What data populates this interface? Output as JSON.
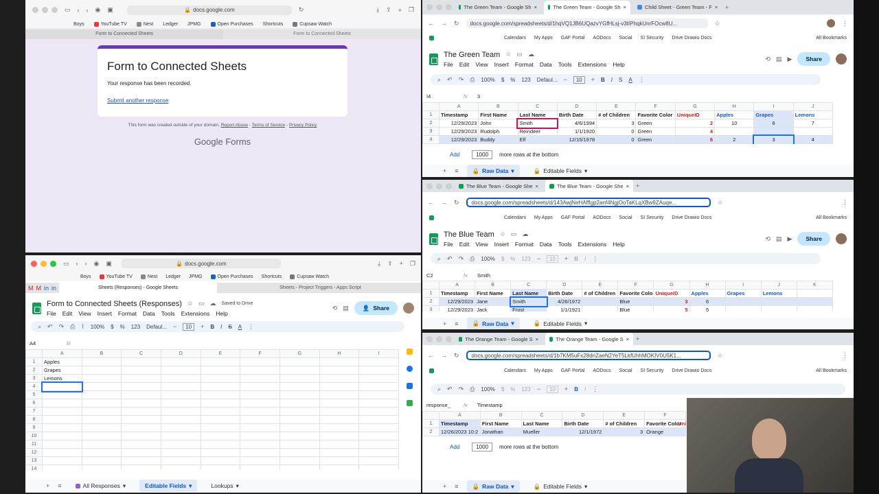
{
  "form_window": {
    "url": "docs.google.com",
    "bookmarks": [
      "Boys",
      "YouTube TV",
      "Nest",
      "Ledger",
      "JPMG",
      "Open Purchases",
      "Shortcuts",
      "Cupsaw Watch"
    ],
    "tabs": [
      "Form to Connected Sheets",
      "Form to Connected Sheets"
    ],
    "title": "Form to Connected Sheets",
    "message": "Your response has been recorded.",
    "link": "Submit another response",
    "footer_pre": "This form was created outside of your domain.",
    "report": "Report Abuse",
    "terms": "Terms of Service",
    "privacy": "Privacy Policy",
    "brand": "Google Forms"
  },
  "responses_window": {
    "url": "docs.google.com",
    "bookmarks": [
      "Boys",
      "YouTube TV",
      "Nest",
      "Ledger",
      "JPMG",
      "Open Purchases",
      "Shortcuts",
      "Cupsaw Watch"
    ],
    "tabs": [
      "Sheets (Responses) - Google Sheets",
      "Sheets - Project Triggers - Apps Script"
    ],
    "doc_title": "Form to Connected Sheets (Responses)",
    "saved": "Saved to Drive",
    "menu": [
      "File",
      "Edit",
      "View",
      "Insert",
      "Format",
      "Data",
      "Tools",
      "Extensions",
      "Help"
    ],
    "share": "Share",
    "zoom": "100%",
    "font": "Defaul...",
    "font_size": "10",
    "num_fmt": "123",
    "cell_ref": "A4",
    "fx": "fx",
    "columns": [
      "A",
      "B",
      "C",
      "D",
      "E",
      "F",
      "G",
      "H",
      "I"
    ],
    "rows": [
      [
        "Apples"
      ],
      [
        "Grapes"
      ],
      [
        "Lemons"
      ],
      [
        ""
      ],
      [
        ""
      ],
      [
        ""
      ],
      [
        ""
      ],
      [
        ""
      ],
      [
        ""
      ],
      [
        ""
      ],
      [
        ""
      ],
      [
        ""
      ],
      [
        ""
      ],
      [
        ""
      ]
    ],
    "sheet_tabs": [
      "All Responses",
      "Editable Fields",
      "Lookups"
    ]
  },
  "green_window": {
    "tabs": [
      "The Green Team - Google Sh",
      "The Green Team - Google Sh",
      "Child Sheet - Green Team - F"
    ],
    "url": "docs.google.com/spreadsheets/d/1hqVQ1JB6UQazvYGfHLsj-v3tIPhqkUnrFOcw8U...",
    "bookmarks": [
      "Calendars",
      "My Apps",
      "GAF Portal",
      "AODocs",
      "Social",
      "SI Security",
      "Drive Drawio Docs",
      "All Bookmarks"
    ],
    "doc_title": "The Green Team",
    "menu": [
      "File",
      "Edit",
      "View",
      "Insert",
      "Format",
      "Data",
      "Tools",
      "Extensions",
      "Help"
    ],
    "share": "Share",
    "zoom": "100%",
    "font": "Defaul...",
    "font_size": "10",
    "num_fmt": "123",
    "cell_ref": "I4",
    "formula": "3",
    "columns": [
      "A",
      "B",
      "C",
      "D",
      "E",
      "F",
      "G",
      "H",
      "I",
      "J"
    ],
    "headers": [
      "Timestamp",
      "First Name",
      "Last Name",
      "Birth Date",
      "# of Children",
      "Favorite Color",
      "UniqueID",
      "Apples",
      "Grapes",
      "Lemons"
    ],
    "rows": [
      [
        "12/29/2023",
        "John",
        "Smith",
        "4/6/1994",
        "3",
        "Green",
        "2",
        "10",
        "6",
        "7"
      ],
      [
        "12/29/2023",
        "Rudolph",
        "Reindeer",
        "1/1/1920",
        "0",
        "Green",
        "4",
        "",
        "",
        ""
      ],
      [
        "12/29/2023",
        "Buddy",
        "Elf",
        "12/15/1978",
        "0",
        "Green",
        "6",
        "2",
        "3",
        "4"
      ]
    ],
    "add": "Add",
    "add_count": "1000",
    "add_text": "more rows at the bottom",
    "sheet_tabs": [
      "Raw Data",
      "Editable Fields"
    ]
  },
  "blue_window": {
    "tabs": [
      "The Blue Team - Google She",
      "The Blue Team - Google She"
    ],
    "url": "docs.google.com/spreadsheets/d/143AwjNeHAfflgp2anf4NgjOoTaKLqXBw9ZAuqe...",
    "bookmarks": [
      "Calendars",
      "My Apps",
      "GAF Portal",
      "AODocs",
      "Social",
      "SI Security",
      "Drive Drawio Docs",
      "All Bookmarks"
    ],
    "doc_title": "The Blue Team",
    "menu": [
      "File",
      "Edit",
      "View",
      "Insert",
      "Format",
      "Data",
      "Tools",
      "Extensions",
      "Help"
    ],
    "share": "Share",
    "zoom": "100%",
    "font_size": "10",
    "num_fmt": "123",
    "cell_ref": "C2",
    "formula": "Smith",
    "columns": [
      "A",
      "B",
      "C",
      "D",
      "E",
      "F",
      "G",
      "H",
      "I",
      "J",
      "K"
    ],
    "headers": [
      "Timestamp",
      "First Name",
      "Last Name",
      "Birth Date",
      "# of Children",
      "Favorite Color",
      "UniqueID",
      "Apples",
      "Grapes",
      "Lemons",
      ""
    ],
    "rows": [
      [
        "12/29/2023",
        "Jane",
        "Smith",
        "4/26/1972",
        "",
        "Blue",
        "3",
        "6",
        "",
        "",
        ""
      ],
      [
        "12/29/2023",
        "Jack",
        "Frost",
        "1/1/1921",
        "",
        "Blue",
        "5",
        "5",
        "",
        "",
        ""
      ]
    ],
    "sheet_tabs": [
      "Raw Data",
      "Editable Fields"
    ]
  },
  "orange_window": {
    "tabs": [
      "The Orange Team - Google S",
      "The Orange Team - Google S"
    ],
    "url": "docs.google.com/spreadsheets/d/1b7KM5uFx28dnZaeN2YeT5LkfUhhMOKIV0U5K1...",
    "bookmarks": [
      "Calendars",
      "My Apps",
      "GAF Portal",
      "AODocs",
      "Social",
      "SI Security",
      "Drive Drawio Docs",
      "All Bookmarks"
    ],
    "zoom": "100%",
    "font_size": "10",
    "num_fmt": "123",
    "cell_ref": "response_",
    "formula": "Timestamp",
    "columns": [
      "A",
      "B",
      "C",
      "D",
      "E",
      "F"
    ],
    "headers": [
      "Timestamp",
      "First Name",
      "Last Name",
      "Birth Date",
      "# of Children",
      "Favorite Color"
    ],
    "rows": [
      [
        "12/26/2023 10:2",
        "Jonathan",
        "Mueller",
        "12/1/1972",
        "3",
        "Orange"
      ]
    ],
    "extra_header": "Uni",
    "add": "Add",
    "add_count": "1000",
    "add_text": "more rows at the bottom",
    "sheet_tabs": [
      "Raw Data",
      "Editable Fields"
    ]
  },
  "colors": {
    "form_bg": "#ede7f6",
    "form_accent": "#673ab7",
    "sheets_green": "#0f9d58",
    "selection": "#dbe6fb",
    "unique_red": "#c5221f"
  }
}
